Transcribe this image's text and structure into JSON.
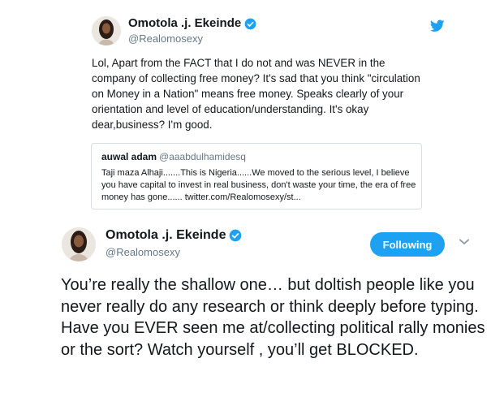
{
  "tweet_1": {
    "author_name": "Omotola .j. Ekeinde",
    "author_handle": "@Realomosexy",
    "verified": true,
    "platform_icon": "twitter-bird-icon",
    "body": "Lol, Apart from the FACT that I do not and was NEVER in the company of collecting free money? It's sad that you think \"circulation on Money in a Nation\" means free money. Speaks clearly of your orientation and level of education/understanding. It's okay dear,business? I'm good.",
    "quoted_tweet": {
      "author_name": "auwal adam",
      "author_handle": "@aaabdulhamidesq",
      "body": "Taji maza Alhaji.......This is Nigeria......We moved to the serious level, I believe you have capital to invest in real  business, don't waste your time, the era of free money has gone...... twitter.com/Realomosexy/st..."
    }
  },
  "tweet_2": {
    "author_name": "Omotola .j. Ekeinde",
    "author_handle": "@Realomosexy",
    "verified": true,
    "follow_button_label": "Following",
    "menu_icon": "chevron-down-icon",
    "body": "You’re really the shallow one… but doltish people like you never really do any research or think deeply before typing. Have you EVER seen me at/collecting political rally monies or the sort? Watch yourself , you’ll get BLOCKED."
  },
  "colors": {
    "accent": "#1da1f2",
    "text": "#14171a",
    "secondary_text": "#657786",
    "border": "#d6dde3"
  }
}
